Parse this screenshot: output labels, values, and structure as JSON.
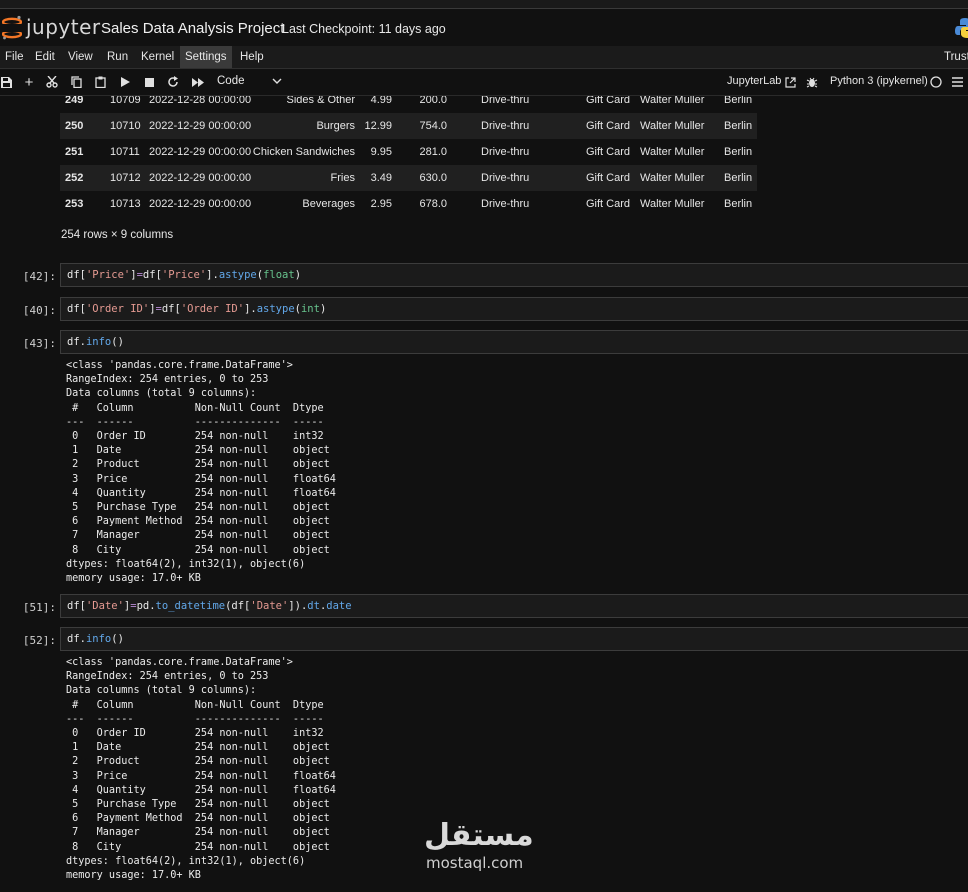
{
  "app": {
    "logo_text": "jupyter",
    "notebook_title": "Sales Data Analysis Project",
    "checkpoint": "Last Checkpoint: 11 days ago"
  },
  "menu": {
    "items": [
      "File",
      "Edit",
      "View",
      "Run",
      "Kernel",
      "Settings",
      "Help"
    ],
    "active": "Settings",
    "trusted_label": "Trusted"
  },
  "toolbar": {
    "cell_type": "Code",
    "jupyterlab_label": "JupyterLab",
    "kernel_label": "Python 3 (ipykernel)",
    "icons": [
      "save-icon",
      "add-cell-icon",
      "cut-icon",
      "copy-icon",
      "paste-icon",
      "run-icon",
      "stop-icon",
      "restart-icon",
      "fast-forward-icon",
      "external-link-icon",
      "debugger-icon",
      "kernel-status-icon",
      "menu-icon"
    ]
  },
  "table": {
    "rows": [
      {
        "idx": "249",
        "order_id": "10709",
        "date": "2022-12-28 00:00:00",
        "product": "Sides & Other",
        "price": "4.99",
        "quantity": "200.0",
        "purchase_type": "Drive-thru",
        "payment": "Gift Card",
        "manager": "Walter Muller",
        "city": "Berlin"
      },
      {
        "idx": "250",
        "order_id": "10710",
        "date": "2022-12-29 00:00:00",
        "product": "Burgers",
        "price": "12.99",
        "quantity": "754.0",
        "purchase_type": "Drive-thru",
        "payment": "Gift Card",
        "manager": "Walter Muller",
        "city": "Berlin"
      },
      {
        "idx": "251",
        "order_id": "10711",
        "date": "2022-12-29 00:00:00",
        "product": "Chicken Sandwiches",
        "price": "9.95",
        "quantity": "281.0",
        "purchase_type": "Drive-thru",
        "payment": "Gift Card",
        "manager": "Walter Muller",
        "city": "Berlin"
      },
      {
        "idx": "252",
        "order_id": "10712",
        "date": "2022-12-29 00:00:00",
        "product": "Fries",
        "price": "3.49",
        "quantity": "630.0",
        "purchase_type": "Drive-thru",
        "payment": "Gift Card",
        "manager": "Walter Muller",
        "city": "Berlin"
      },
      {
        "idx": "253",
        "order_id": "10713",
        "date": "2022-12-29 00:00:00",
        "product": "Beverages",
        "price": "2.95",
        "quantity": "678.0",
        "purchase_type": "Drive-thru",
        "payment": "Gift Card",
        "manager": "Walter Muller",
        "city": "Berlin"
      }
    ],
    "shape_text": "254 rows × 9 columns"
  },
  "cells": [
    {
      "prompt": "[42]:",
      "code": [
        [
          "df",
          ""
        ],
        [
          "[",
          ""
        ],
        [
          "'Price'",
          "str"
        ],
        [
          "]",
          ""
        ],
        [
          "=",
          "op"
        ],
        [
          "df",
          ""
        ],
        [
          "[",
          ""
        ],
        [
          "'Price'",
          "str"
        ],
        [
          "].",
          ""
        ],
        [
          "astype",
          "attr"
        ],
        [
          "(",
          ""
        ],
        [
          "float",
          "bi"
        ],
        [
          ")",
          ""
        ]
      ],
      "output": ""
    },
    {
      "prompt": "[40]:",
      "code": [
        [
          "df",
          ""
        ],
        [
          "[",
          ""
        ],
        [
          "'Order ID'",
          "str"
        ],
        [
          "]",
          ""
        ],
        [
          "=",
          "op"
        ],
        [
          "df",
          ""
        ],
        [
          "[",
          ""
        ],
        [
          "'Order ID'",
          "str"
        ],
        [
          "].",
          ""
        ],
        [
          "astype",
          "attr"
        ],
        [
          "(",
          ""
        ],
        [
          "int",
          "bi"
        ],
        [
          ")",
          ""
        ]
      ],
      "output": ""
    },
    {
      "prompt": "[43]:",
      "code": [
        [
          "df.",
          ""
        ],
        [
          "info",
          "attr"
        ],
        [
          "()",
          ""
        ]
      ],
      "output": "<class 'pandas.core.frame.DataFrame'>\nRangeIndex: 254 entries, 0 to 253\nData columns (total 9 columns):\n #   Column          Non-Null Count  Dtype  \n---  ------          --------------  -----  \n 0   Order ID        254 non-null    int32  \n 1   Date            254 non-null    object \n 2   Product         254 non-null    object \n 3   Price           254 non-null    float64\n 4   Quantity        254 non-null    float64\n 5   Purchase Type   254 non-null    object \n 6   Payment Method  254 non-null    object \n 7   Manager         254 non-null    object \n 8   City            254 non-null    object \ndtypes: float64(2), int32(1), object(6)\nmemory usage: 17.0+ KB"
    },
    {
      "prompt": "[51]:",
      "code": [
        [
          "df",
          ""
        ],
        [
          "[",
          ""
        ],
        [
          "'Date'",
          "str"
        ],
        [
          "]",
          ""
        ],
        [
          "=",
          "op"
        ],
        [
          "pd.",
          ""
        ],
        [
          "to_datetime",
          "attr"
        ],
        [
          "(df[",
          ""
        ],
        [
          "'Date'",
          "str"
        ],
        [
          "]).",
          ""
        ],
        [
          "dt",
          "attr"
        ],
        [
          ".",
          ""
        ],
        [
          "date",
          "attr"
        ]
      ],
      "output": ""
    },
    {
      "prompt": "[52]:",
      "code": [
        [
          "df.",
          ""
        ],
        [
          "info",
          "attr"
        ],
        [
          "()",
          ""
        ]
      ],
      "output": "<class 'pandas.core.frame.DataFrame'>\nRangeIndex: 254 entries, 0 to 253\nData columns (total 9 columns):\n #   Column          Non-Null Count  Dtype  \n---  ------          --------------  -----  \n 0   Order ID        254 non-null    int32  \n 1   Date            254 non-null    object \n 2   Product         254 non-null    object \n 3   Price           254 non-null    float64\n 4   Quantity        254 non-null    float64\n 5   Purchase Type   254 non-null    object \n 6   Payment Method  254 non-null    object \n 7   Manager         254 non-null    object \n 8   City            254 non-null    object \ndtypes: float64(2), int32(1), object(6)\nmemory usage: 17.0+ KB"
    }
  ],
  "watermark": {
    "arabic": "مستقل",
    "latin": "mostaql.com"
  }
}
